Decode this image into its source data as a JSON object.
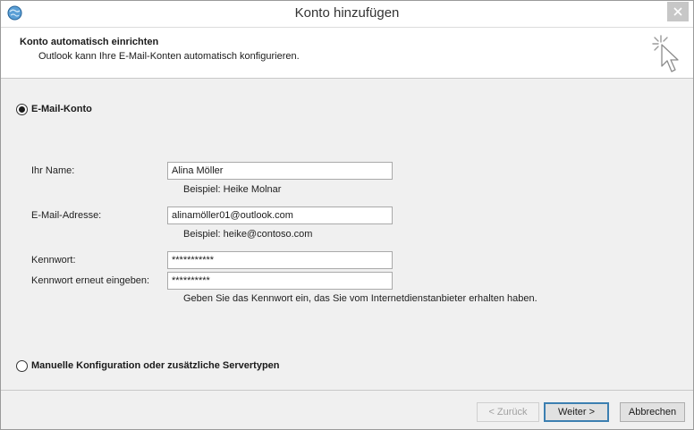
{
  "window": {
    "title": "Konto hinzufügen"
  },
  "header": {
    "title": "Konto automatisch einrichten",
    "subtitle": "Outlook kann Ihre E-Mail-Konten automatisch konfigurieren."
  },
  "options": {
    "email_account": {
      "label": "E-Mail-Konto",
      "selected": true
    },
    "manual": {
      "label": "Manuelle Konfiguration oder zusätzliche Servertypen",
      "selected": false
    }
  },
  "form": {
    "name": {
      "label": "Ihr Name:",
      "value": "Alina Möller",
      "hint": "Beispiel: Heike Molnar"
    },
    "email": {
      "label": "E-Mail-Adresse:",
      "value": "alinamöller01@outlook.com",
      "hint": "Beispiel: heike@contoso.com"
    },
    "password": {
      "label": "Kennwort:",
      "value": "***********"
    },
    "password_confirm": {
      "label": "Kennwort erneut eingeben:",
      "value": "**********"
    },
    "password_hint": "Geben Sie das Kennwort ein, das Sie vom Internetdienstanbieter erhalten haben."
  },
  "buttons": {
    "back": "< Zurück",
    "next": "Weiter >",
    "cancel": "Abbrechen"
  },
  "icons": {
    "app": "outlook-globe-icon",
    "close": "close-icon",
    "wizard": "click-cursor-icon"
  },
  "colors": {
    "accent": "#3c7fb1",
    "close_bg": "#c7c7c7",
    "body_bg": "#f0f0f0"
  }
}
